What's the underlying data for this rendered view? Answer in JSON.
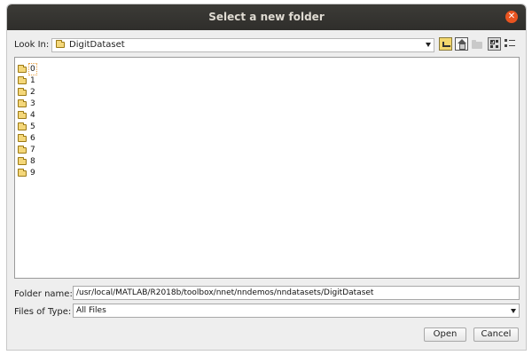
{
  "dialog": {
    "title": "Select a new folder"
  },
  "look_in": {
    "label": "Look In:",
    "value": "DigitDataset"
  },
  "toolbar": {
    "icons": [
      "up-one-level-icon",
      "home-icon",
      "new-folder-icon",
      "list-view-icon",
      "details-view-icon"
    ]
  },
  "file_list": {
    "items": [
      "0",
      "1",
      "2",
      "3",
      "4",
      "5",
      "6",
      "7",
      "8",
      "9"
    ],
    "selected": "0"
  },
  "folder_name": {
    "label": "Folder name:",
    "value": "/usr/local/MATLAB/R2018b/toolbox/nnet/nndemos/nndatasets/DigitDataset"
  },
  "files_of_type": {
    "label": "Files of Type:",
    "value": "All Files"
  },
  "buttons": {
    "open": "Open",
    "cancel": "Cancel"
  },
  "colors": {
    "titlebar": "#3c3b37",
    "close": "#e95420",
    "folder": "#f4d77a"
  }
}
